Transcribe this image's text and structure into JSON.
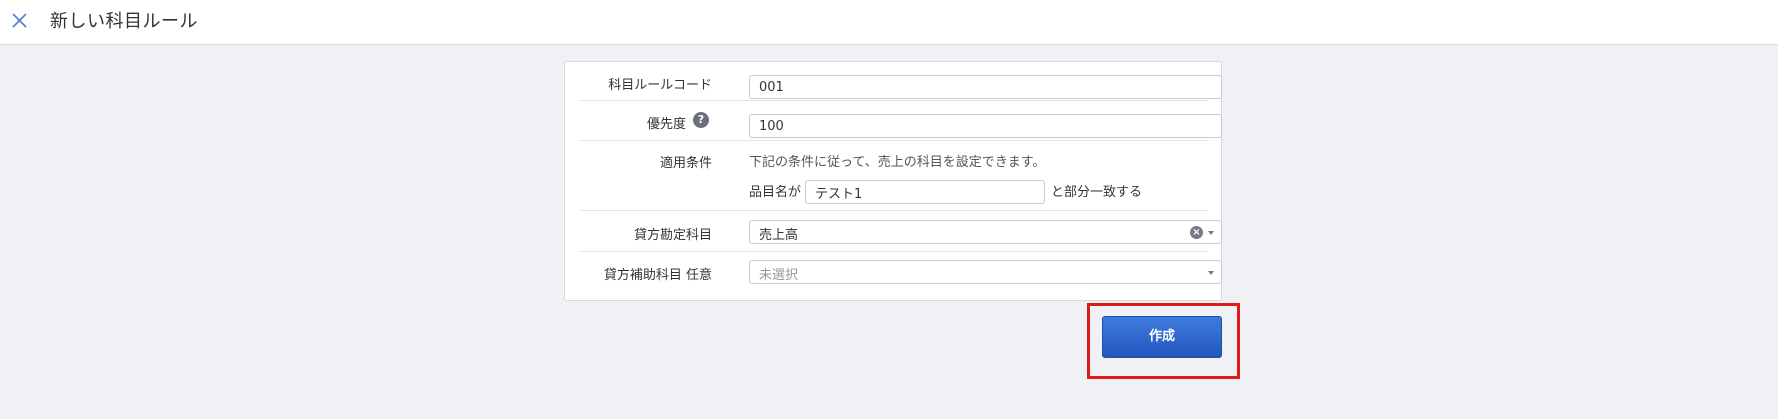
{
  "header": {
    "title": "新しい科目ルール"
  },
  "form": {
    "code": {
      "label": "科目ルールコード",
      "value": "001"
    },
    "priority": {
      "label": "優先度",
      "value": "100",
      "help_glyph": "?"
    },
    "condition": {
      "label": "適用条件",
      "description": "下記の条件に従って、売上の科目を設定できます。",
      "prefix": "品目名が",
      "value": "テスト1",
      "suffix": "と部分一致する"
    },
    "credit_account": {
      "label": "貸方勘定科目",
      "value": "売上高"
    },
    "credit_sub_account": {
      "label": "貸方補助科目 任意",
      "placeholder": "未選択"
    }
  },
  "actions": {
    "create_label": "作成"
  },
  "colors": {
    "primary": "#2a63cc",
    "highlight": "#e0191b",
    "background": "#f0f1f5"
  }
}
